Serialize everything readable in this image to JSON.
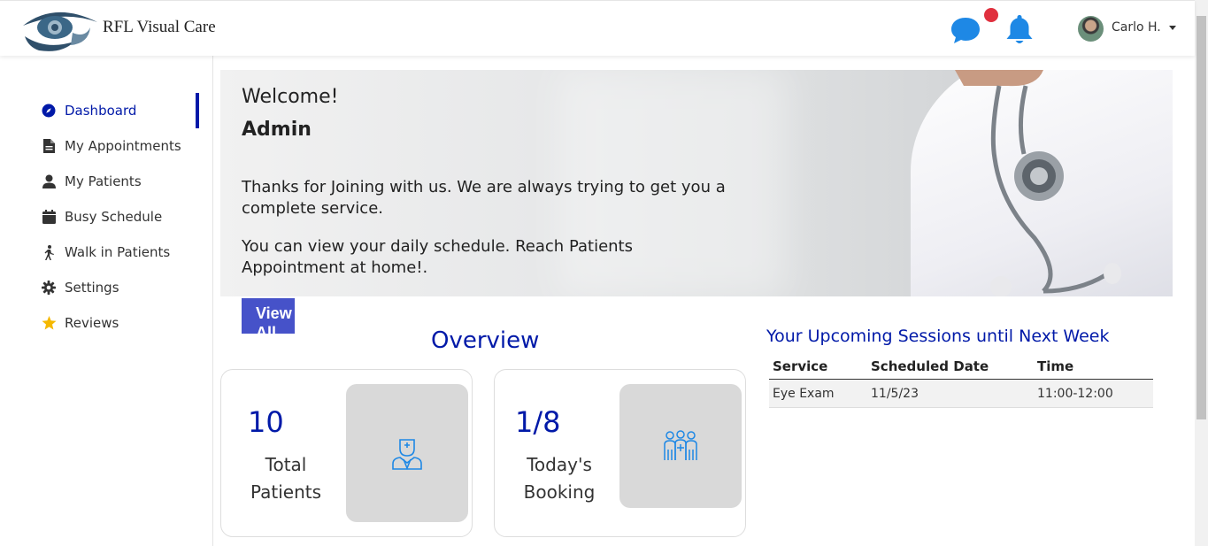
{
  "header": {
    "brand": "RFL Visual Care",
    "user_name": "Carlo H."
  },
  "sidebar": {
    "items": [
      {
        "label": "Dashboard",
        "icon": "compass-icon",
        "active": true
      },
      {
        "label": "My Appointments",
        "icon": "document-icon"
      },
      {
        "label": "My Patients",
        "icon": "user-icon"
      },
      {
        "label": "Busy Schedule",
        "icon": "calendar-icon"
      },
      {
        "label": "Walk in Patients",
        "icon": "walking-icon"
      },
      {
        "label": "Settings",
        "icon": "gear-icon"
      },
      {
        "label": "Reviews",
        "icon": "star-icon"
      }
    ]
  },
  "hero": {
    "welcome": "Welcome!",
    "name": "Admin",
    "line1": "Thanks for Joining with us. We are always trying to get you a complete service.",
    "line2": "You can view your daily schedule. Reach Patients Appointment at home!.",
    "button": "View All"
  },
  "overview": {
    "title": "Overview",
    "cards": [
      {
        "value": "10",
        "label_line1": "Total",
        "label_line2": "Patients",
        "icon": "doctor-icon"
      },
      {
        "value": "1/8",
        "label_line1": "Today's",
        "label_line2": "Booking",
        "icon": "group-icon"
      }
    ]
  },
  "sessions": {
    "title": "Your Upcoming Sessions until Next Week",
    "columns": [
      "Service",
      "Scheduled Date",
      "Time"
    ],
    "rows": [
      [
        "Eye Exam",
        "11/5/23",
        "11:00-12:00"
      ]
    ]
  },
  "colors": {
    "accent": "#0019a8",
    "button": "#4652c9",
    "notification": "#e0303e",
    "icon_blue": "#1e88e5"
  }
}
